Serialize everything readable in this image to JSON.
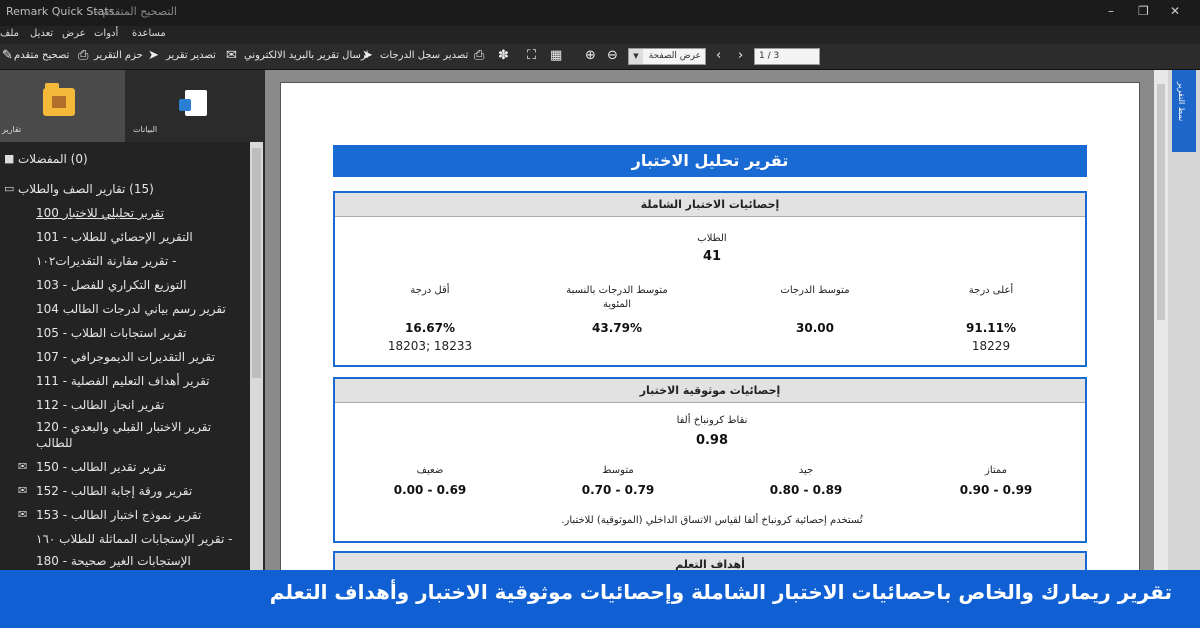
{
  "window": {
    "app_name": "Remark Quick Stats",
    "mid_title": "التصحيح المتقدم -"
  },
  "menu": [
    "مساعدة",
    "أدوات",
    "عرض",
    "تعديل",
    "ملف"
  ],
  "toolbar": {
    "advanced_grading": "تصحيح متقدم",
    "report_package": "حزم التقرير",
    "export_report": "تصدير تقرير",
    "email_report": "ارسال تقرير بالبريد الالكتروني",
    "export_grade_log": "تصدير سجل الدرجات",
    "page_view": "عرض الصفحة",
    "page_counter": "1 / 3"
  },
  "left_tabs": {
    "reports": "تقارير",
    "data": "البيانات"
  },
  "tree": {
    "favorites": "(0) المفضلات",
    "class_group": "(15) تقارير الصف والطلاب",
    "items": [
      "تقرير تحليلي للاختبار 100",
      "التقرير الإحصائي للطلاب - 101",
      "- تقرير مقارنة التقديرات١٠٢",
      "التوزيع التكراري للفصل - 103",
      "تقرير رسم بياني لدرجات الطالب 104",
      "تقرير استجابات الطلاب - 105",
      "تقرير التقديرات الديموجرافي - 107",
      "تقرير أهداف التعليم الفصلية - 111",
      "تقرير انجاز الطالب - 112",
      "تقرير الاختبار القبلي والبعدي - 120",
      "للطالب",
      "تقرير تقدير الطالب - 150",
      "تقرير ورقة إجابة الطالب - 152",
      "تقرير نموذج اختبار الطالب - 153",
      "- تقرير الإستجابات المماثلة للطلاب ١٦٠",
      "الإستجابات الغير صحيحة - 180"
    ]
  },
  "right_panel": {
    "label": "نمط التقرير"
  },
  "report": {
    "title": "تقرير تحليل الاختبار",
    "overall": {
      "header": "إحصائيات الاختبار الشاملة",
      "students_label": "الطلاب",
      "students_value": "41",
      "highest_label": "أعلى درجة",
      "highest_value": "91.11%",
      "highest_id": "18229",
      "mean_label": "متوسط الدرجات",
      "mean_value": "30.00",
      "mean_pct_label": "متوسط الدرجات بالنسبة",
      "mean_pct_label2": "المئوية",
      "mean_pct_value": "43.79%",
      "lowest_label": "أقل درجة",
      "lowest_value": "16.67%",
      "lowest_ids": "18203; 18233"
    },
    "reliability": {
      "header": "إحصائيات موثوقية الاختبار",
      "kr_label": "نقاط كرونباخ ألفا",
      "kr_value": "0.98",
      "excellent_label": "ممتاز",
      "excellent_value": "0.90 - 0.99",
      "good_label": "جيد",
      "good_value": "0.80 - 0.89",
      "medium_label": "متوسط",
      "medium_value": "0.70 - 0.79",
      "weak_label": "ضعيف",
      "weak_value": "0.00 - 0.69",
      "note": "تُستخدم إحصائية كرونباخ ألفا لقياس الاتساق الداخلي (الموثوقية) للاختبار."
    },
    "objectives": {
      "header": "أهداف التعلم"
    }
  },
  "caption": "تقرير ريمارك والخاص باحصائيات الاختبار الشاملة وإحصائيات موثوقية الاختبار وأهداف التعلم",
  "colors": {
    "accent": "#1a6ad4",
    "caption_bg": "#1060d4",
    "folder": "#f5b93a"
  }
}
